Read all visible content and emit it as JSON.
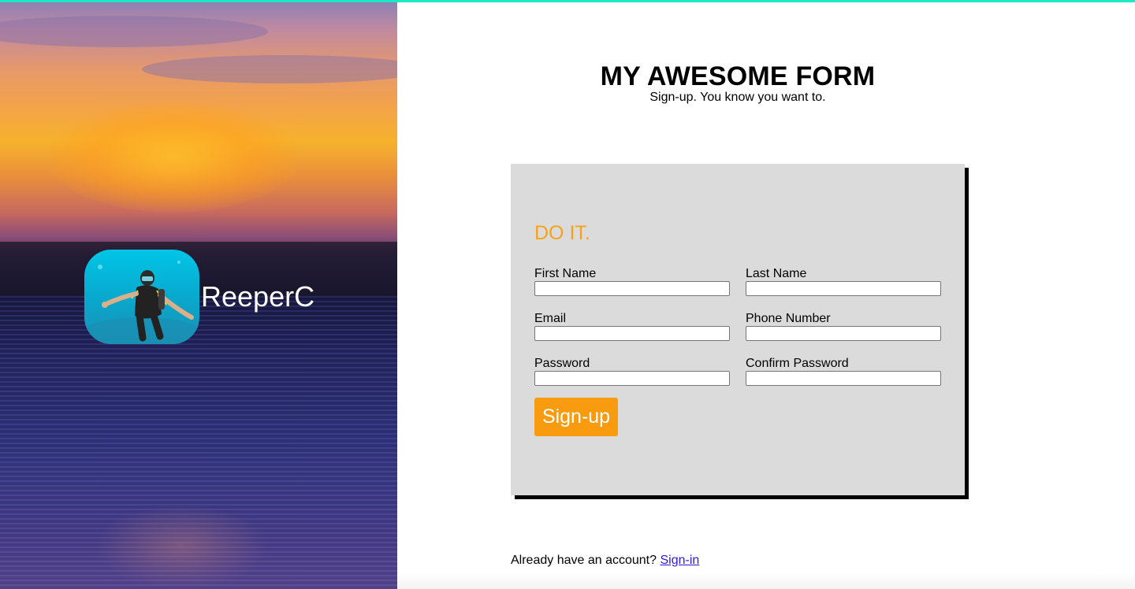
{
  "hero": {
    "username": "ReeperC"
  },
  "header": {
    "title": "MY AWESOME FORM",
    "subtitle": "Sign-up. You know you want to."
  },
  "form": {
    "heading": "DO IT.",
    "fields": {
      "first_name": {
        "label": "First Name",
        "value": ""
      },
      "last_name": {
        "label": "Last Name",
        "value": ""
      },
      "email": {
        "label": "Email",
        "value": ""
      },
      "phone": {
        "label": "Phone Number",
        "value": ""
      },
      "password": {
        "label": "Password",
        "value": ""
      },
      "confirm_password": {
        "label": "Confirm Password",
        "value": ""
      }
    },
    "submit_label": "Sign-up"
  },
  "footer": {
    "prompt": "Already have an account?",
    "signin_link": "Sign-in"
  },
  "colors": {
    "accent_top": "#1de9c6",
    "heading_orange": "#f7a21a",
    "button_orange": "#f89b0f",
    "card_bg": "#dbdbdb",
    "link": "#2d1adb"
  }
}
